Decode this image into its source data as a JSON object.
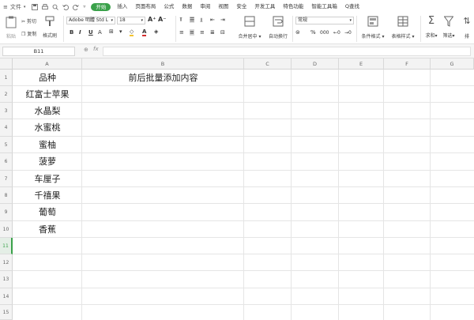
{
  "menubar": {
    "file_label": "文件",
    "quick_icons": [
      "save-icon",
      "print-icon",
      "preview-icon",
      "undo-icon",
      "redo-icon",
      "more-icon"
    ],
    "tabs": [
      {
        "label": "开始",
        "active": true
      },
      {
        "label": "插入"
      },
      {
        "label": "页面布局"
      },
      {
        "label": "公式"
      },
      {
        "label": "数据"
      },
      {
        "label": "审阅"
      },
      {
        "label": "视图"
      },
      {
        "label": "安全"
      },
      {
        "label": "开发工具"
      },
      {
        "label": "特色功能"
      },
      {
        "label": "智能工具箱"
      }
    ],
    "search_label": "Q查找",
    "accent": "#3aa14a"
  },
  "ribbon": {
    "cut": "剪切",
    "paste": "粘贴",
    "copy": "复制",
    "format_painter": "格式刷",
    "font_name": "Adobe 明體 Std L",
    "font_size": "18",
    "bold": "B",
    "italic": "I",
    "underline": "U",
    "merge_center": "合并居中",
    "wrap_text": "自动换行",
    "number_format": "常规",
    "percent": "%",
    "thousands": "000",
    "conditional_format": "条件格式",
    "table_style": "表格样式",
    "sum": "求和",
    "filter": "筛选",
    "sort": "排"
  },
  "formula_bar": {
    "name_box": "B11",
    "fx": "fx",
    "formula": ""
  },
  "sheet": {
    "columns": [
      "A",
      "B",
      "C",
      "D",
      "E",
      "F",
      "G"
    ],
    "rows": [
      "1",
      "2",
      "3",
      "4",
      "5",
      "6",
      "7",
      "8",
      "9",
      "10",
      "11",
      "12",
      "13",
      "14",
      "15"
    ],
    "selected_row": "11",
    "cells": {
      "A": [
        "品种",
        "红富士苹果",
        "水晶梨",
        "水蜜桃",
        "蜜柚",
        "菠萝",
        "车厘子",
        "千禧果",
        "葡萄",
        "香蕉"
      ],
      "B1": "前后批量添加内容"
    }
  }
}
